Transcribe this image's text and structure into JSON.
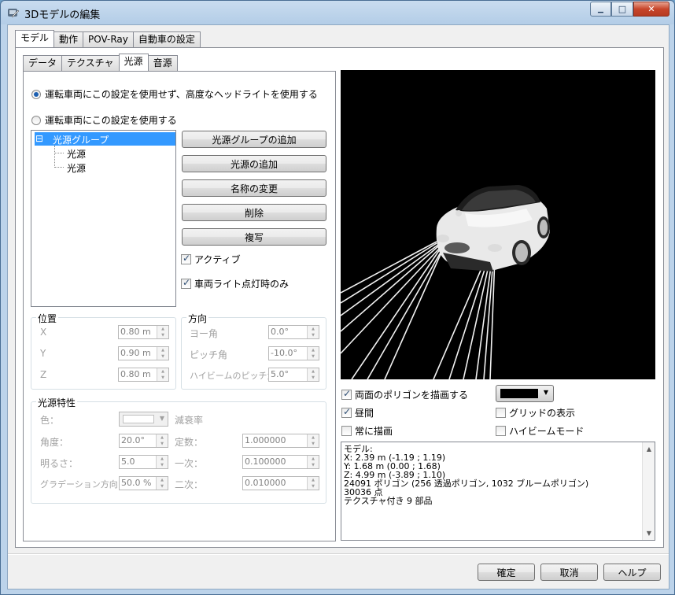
{
  "window": {
    "title": "3Dモデルの編集",
    "min_symbol": "▁",
    "max_symbol": "□",
    "close_symbol": "✕"
  },
  "tabs": [
    "モデル",
    "動作",
    "POV-Ray",
    "自動車の設定"
  ],
  "subtabs": [
    "データ",
    "テクスチャ",
    "光源",
    "音源"
  ],
  "light_mode": {
    "option_advanced": "運転車両にこの設定を使用せず、高度なヘッドライトを使用する",
    "option_use": "運転車両にこの設定を使用する",
    "selected": "option_advanced"
  },
  "tree": {
    "expander": "⊟",
    "group": "光源グループ",
    "children": [
      "光源",
      "光源"
    ]
  },
  "buttons": {
    "add_group": "光源グループの追加",
    "add_light": "光源の追加",
    "rename": "名称の変更",
    "delete": "削除",
    "duplicate": "複写"
  },
  "checks": {
    "active": "アクティブ",
    "active_checked": true,
    "lights_on_only": "車両ライト点灯時のみ",
    "lights_on_only_checked": true
  },
  "position": {
    "title": "位置",
    "x_label": "X",
    "x_value": "0.80 m",
    "y_label": "Y",
    "y_value": "0.90 m",
    "z_label": "Z",
    "z_value": "0.80 m"
  },
  "direction": {
    "title": "方向",
    "yaw_label": "ヨー角",
    "yaw_value": "0.0°",
    "pitch_label": "ピッチ角",
    "pitch_value": "-10.0°",
    "hb_pitch_label": "ハイビームのピッチ角",
    "hb_pitch_value": "5.0°"
  },
  "light_props": {
    "title": "光源特性",
    "color_label": "色：",
    "attenuation_label": "減衰率",
    "angle_label": "角度：",
    "angle_value": "20.0°",
    "const_label": "定数：",
    "const_value": "1.000000",
    "brightness_label": "明るさ：",
    "brightness_value": "5.0",
    "linear_label": "一次：",
    "linear_value": "0.100000",
    "gradation_label": "グラデーション方向：",
    "gradation_value": "50.0 %",
    "quad_label": "二次：",
    "quad_value": "0.010000"
  },
  "render_options": {
    "double_sided": "両面のポリゴンを描画する",
    "double_sided_checked": true,
    "daytime": "昼間",
    "daytime_checked": true,
    "grid": "グリッドの表示",
    "grid_checked": false,
    "always_draw": "常に描画",
    "always_draw_checked": false,
    "high_beam": "ハイビームモード",
    "high_beam_checked": false,
    "bg_color": "#000000"
  },
  "model_info": [
    "モデル:",
    "X: 2.39 m (-1.19 ; 1.19)",
    "Y: 1.68 m (0.00 ; 1.68)",
    "Z: 4.99 m (-3.89 ; 1.10)",
    "24091 ポリゴン (256 透過ポリゴン, 1032 ブルームポリゴン)",
    "30036 点",
    "テクスチャ付き 9 部品"
  ],
  "footer": {
    "ok": "確定",
    "cancel": "取消",
    "help": "ヘルプ"
  },
  "colors": {
    "selection": "#3399ff",
    "titlebar": "#b9d1ea",
    "preview_bg": "#000000"
  }
}
